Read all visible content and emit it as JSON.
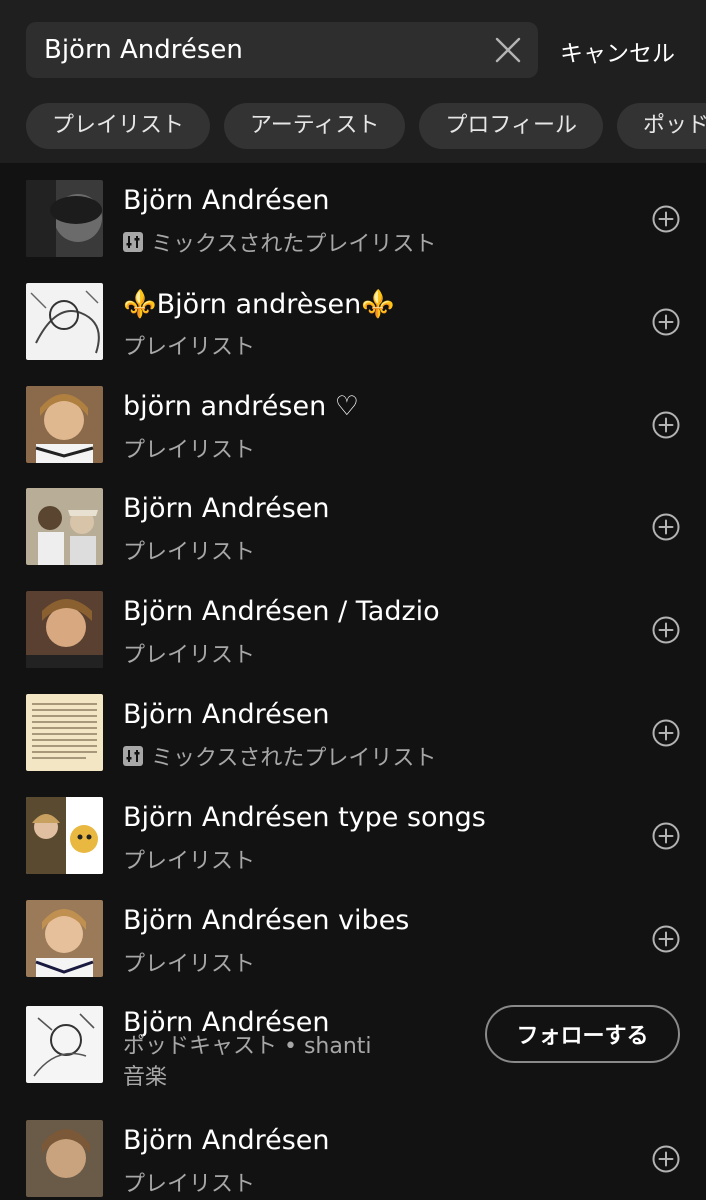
{
  "search": {
    "value": "Björn Andrésen",
    "cancel_label": "キャンセル"
  },
  "filters": [
    "プレイリスト",
    "アーティスト",
    "プロフィール",
    "ポッドキャスト"
  ],
  "results": [
    {
      "title": "Björn Andrésen",
      "subtitle": "ミックスされたプレイリスト",
      "mixed": true,
      "action": "add"
    },
    {
      "title": "⚜️Björn andrèsen⚜️",
      "subtitle": "プレイリスト",
      "mixed": false,
      "action": "add"
    },
    {
      "title": "björn andrésen ♡",
      "subtitle": "プレイリスト",
      "mixed": false,
      "action": "add"
    },
    {
      "title": "Björn Andrésen",
      "subtitle": "プレイリスト",
      "mixed": false,
      "action": "add"
    },
    {
      "title": "Björn Andrésen / Tadzio",
      "subtitle": "プレイリスト",
      "mixed": false,
      "action": "add"
    },
    {
      "title": "Björn Andrésen",
      "subtitle": "ミックスされたプレイリスト",
      "mixed": true,
      "action": "add"
    },
    {
      "title": "Björn Andrésen type songs",
      "subtitle": "プレイリスト",
      "mixed": false,
      "action": "add"
    },
    {
      "title": "Björn Andrésen vibes",
      "subtitle": "プレイリスト",
      "mixed": false,
      "action": "add"
    },
    {
      "title": "Björn Andrésen",
      "subtitle": "ポッドキャスト • shanti",
      "subtitle_line2": "音楽",
      "mixed": false,
      "action": "follow",
      "follow_label": "フォローする"
    },
    {
      "title": "Björn Andrésen",
      "subtitle": "プレイリスト",
      "mixed": false,
      "action": "add"
    }
  ],
  "colors": {
    "background": "#121212",
    "header": "#1f1f1f",
    "chip": "#333333",
    "secondary_text": "#a7a7a7"
  },
  "icons": {
    "clear": "close-icon",
    "add": "add-circle-icon",
    "mix": "mix-icon"
  }
}
